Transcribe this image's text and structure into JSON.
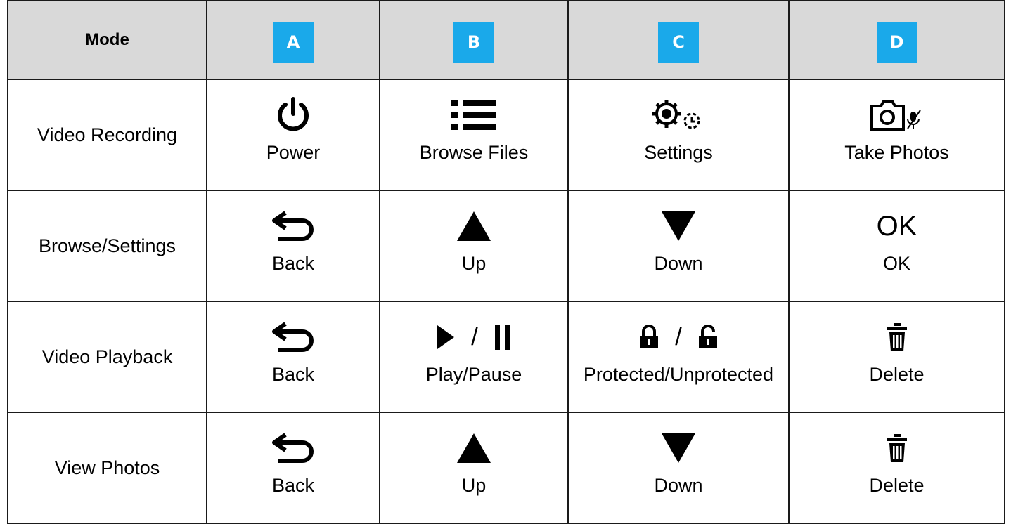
{
  "table": {
    "mode_header": "Mode",
    "keys": [
      {
        "tag": "A",
        "color": "#1aa9ea"
      },
      {
        "tag": "B",
        "color": "#1aa9ea"
      },
      {
        "tag": "C",
        "color": "#1aa9ea"
      },
      {
        "tag": "D",
        "color": "#1aa9ea"
      }
    ],
    "rows": [
      {
        "mode": "Video Recording",
        "cells": [
          {
            "label": "Power",
            "icon": "power-icon"
          },
          {
            "label": "Browse Files",
            "icon": "list-icon"
          },
          {
            "label": "Settings",
            "icon": "settings-icon"
          },
          {
            "label": "Take Photos",
            "icon": "camera-mute-icon"
          }
        ]
      },
      {
        "mode": "Browse/Settings",
        "cells": [
          {
            "label": "Back",
            "icon": "back-arrow-icon"
          },
          {
            "label": "Up",
            "icon": "up-triangle-icon"
          },
          {
            "label": "Down",
            "icon": "down-triangle-icon"
          },
          {
            "label": "OK",
            "icon": "ok-icon",
            "icon_text": "OK"
          }
        ]
      },
      {
        "mode": "Video Playback",
        "cells": [
          {
            "label": "Back",
            "icon": "back-arrow-icon"
          },
          {
            "label": "Play/Pause",
            "icon": "play-pause-icon",
            "separator": "/"
          },
          {
            "label": "Protected/Unprotected",
            "icon": "lock-unlock-icon",
            "separator": "/"
          },
          {
            "label": "Delete",
            "icon": "trash-icon"
          }
        ]
      },
      {
        "mode": "View Photos",
        "cells": [
          {
            "label": "Back",
            "icon": "back-arrow-icon"
          },
          {
            "label": "Up",
            "icon": "up-triangle-icon"
          },
          {
            "label": "Down",
            "icon": "down-triangle-icon"
          },
          {
            "label": "Delete",
            "icon": "trash-icon"
          }
        ]
      }
    ]
  }
}
